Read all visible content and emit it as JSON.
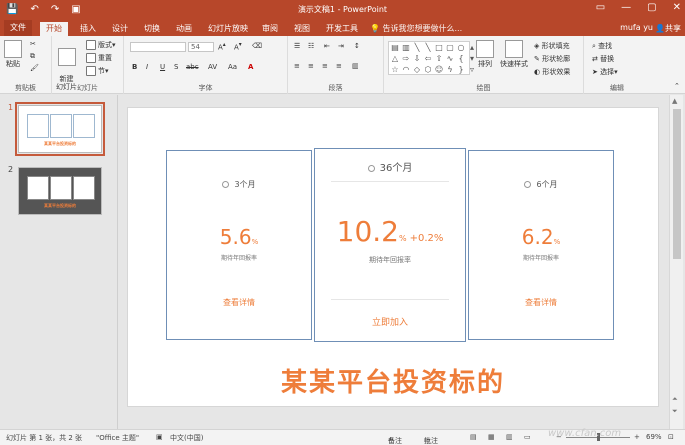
{
  "titlebar": {
    "title": "演示文稿1 - PowerPoint",
    "qat": [
      "💾",
      "↶",
      "↷",
      "▣"
    ],
    "controls": [
      "▭",
      "—",
      "▢",
      "✕"
    ]
  },
  "tabs": {
    "file": "文件",
    "items": [
      "开始",
      "插入",
      "设计",
      "切换",
      "动画",
      "幻灯片放映",
      "审阅",
      "视图",
      "开发工具"
    ],
    "tell_me": "告诉我您想要做什么...",
    "user": "mufa yu",
    "share": "共享"
  },
  "ribbon": {
    "groups": [
      "剪贴板",
      "幻灯片",
      "字体",
      "段落",
      "绘图",
      "编辑"
    ],
    "paste": "粘贴",
    "new_slide": "新建\n幻灯片",
    "layout": "版式",
    "reset": "重置",
    "section": "节",
    "font_size": "54",
    "arrange": "排列",
    "quick_styles": "快速样式",
    "shape_fill": "形状填充",
    "shape_outline": "形状轮廓",
    "shape_effects": "形状效果",
    "find": "查找",
    "replace": "替换",
    "select": "选择",
    "format_buttons": [
      "B",
      "I",
      "U",
      "S",
      "abc",
      "AV",
      "Aa",
      "A"
    ]
  },
  "thumbnails": {
    "items": [
      {
        "num": "1",
        "title": "某某平台投资标的"
      },
      {
        "num": "2",
        "title": "某某平台投资标的"
      }
    ]
  },
  "slide": {
    "cards": [
      {
        "period": "3个月",
        "rate": "5.6",
        "unit": "%",
        "extra": "",
        "caption": "期待年回报率",
        "link": "查看详情"
      },
      {
        "period": "36个月",
        "rate": "10.2",
        "unit": "%",
        "extra": "+0.2%",
        "caption": "期待年回报率",
        "link": "立即加入"
      },
      {
        "period": "6个月",
        "rate": "6.2",
        "unit": "%",
        "extra": "",
        "caption": "期待年回报率",
        "link": "查看详情"
      }
    ],
    "title": "某某平台投资标的"
  },
  "statusbar": {
    "slide_count": "幻灯片 第 1 张，共 2 张",
    "theme": "\"Office 主题\"",
    "language": "中文(中国)",
    "notes": "备注",
    "comments": "批注",
    "zoom": "69%"
  },
  "watermark": "www.cfan.com"
}
